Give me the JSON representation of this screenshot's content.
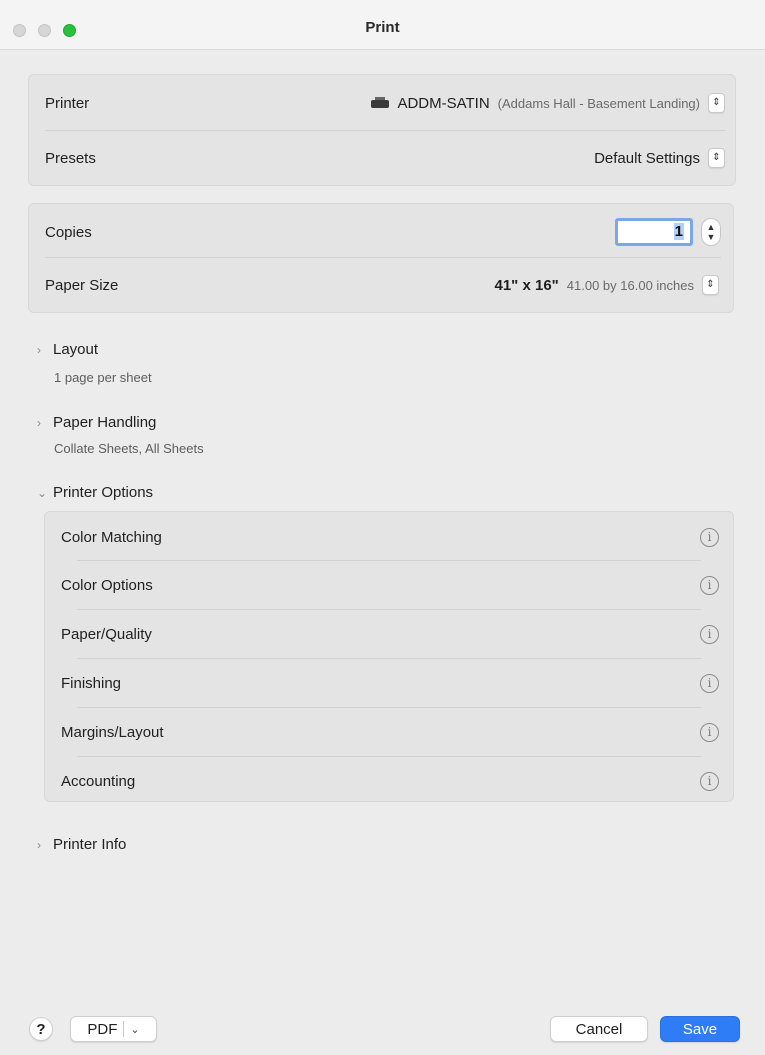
{
  "window": {
    "title": "Print"
  },
  "printer_group": {
    "printer_label": "Printer",
    "printer_name": "ADDM-SATIN",
    "printer_location": "(Addams Hall - Basement Landing)",
    "presets_label": "Presets",
    "presets_value": "Default Settings"
  },
  "copies_group": {
    "copies_label": "Copies",
    "copies_value": "1",
    "paper_size_label": "Paper Size",
    "paper_size_value": "41\" x 16\"",
    "paper_size_detail": "41.00 by 16.00 inches"
  },
  "sections": {
    "layout": {
      "title": "Layout",
      "subtitle": "1 page per sheet"
    },
    "paper_handling": {
      "title": "Paper Handling",
      "subtitle": "Collate Sheets, All Sheets"
    },
    "printer_options": {
      "title": "Printer Options"
    },
    "printer_info": {
      "title": "Printer Info"
    }
  },
  "printer_options": [
    {
      "label": "Color Matching"
    },
    {
      "label": "Color Options"
    },
    {
      "label": "Paper/Quality"
    },
    {
      "label": "Finishing"
    },
    {
      "label": "Margins/Layout"
    },
    {
      "label": "Accounting"
    }
  ],
  "footer": {
    "help_label": "?",
    "pdf_label": "PDF",
    "cancel_label": "Cancel",
    "save_label": "Save"
  },
  "colors": {
    "accent": "#2f7df6",
    "close": "#d6d6d6",
    "zoom": "#29c040"
  },
  "icons": {
    "printer": "printer-icon",
    "info": "info-icon",
    "stepper": "updown-chevron-icon"
  }
}
